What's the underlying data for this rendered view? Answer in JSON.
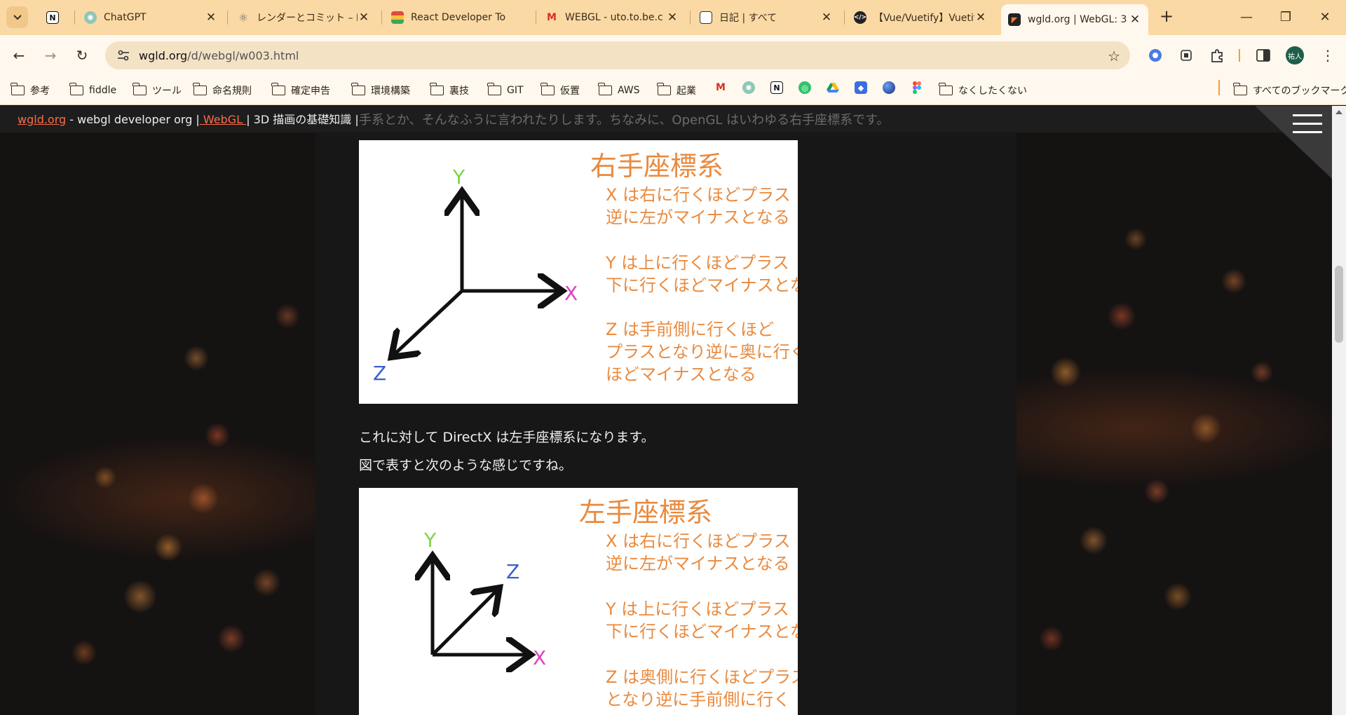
{
  "tabs": [
    {
      "label": "",
      "favicon": "notion-icon"
    },
    {
      "label": "ChatGPT",
      "favicon": "chatgpt-icon"
    },
    {
      "label": "レンダーとコミット – Re",
      "favicon": "react-icon"
    },
    {
      "label": "React Developer To",
      "favicon": "chrome-webstore-icon"
    },
    {
      "label": "WEBGL - uto.to.be.c",
      "favicon": "gmail-icon"
    },
    {
      "label": "日記 | すべて",
      "favicon": "diary-icon"
    },
    {
      "label": "【Vue/Vuetify】Vuetif",
      "favicon": "code-icon"
    },
    {
      "label": "wgld.org | WebGL: 3",
      "favicon": "wgld-icon",
      "active": true
    }
  ],
  "toolbar": {
    "url_host": "wgld.org",
    "url_path": "/d/webgl/w003.html",
    "profile_initials": "祐人"
  },
  "bookmarks": {
    "items": [
      "参考",
      "fiddle",
      "ツール",
      "命名規則",
      "確定申告",
      "環境構築",
      "裏技",
      "GIT",
      "仮置",
      "AWS",
      "起業"
    ],
    "last_folder": "なくしたくない",
    "all_bookmarks": "すべてのブックマーク"
  },
  "site": {
    "home_link": "wgld.org",
    "org_text": " - webgl developer org |",
    "webgl_link": " WebGL ",
    "page_text": "| 3D 描画の基礎知識 |",
    "faded_line": "手系とか、そんなふうに言われたりします。ちなみに、OpenGL はいわゆる右手座標系です。"
  },
  "article": {
    "figure1": {
      "title": "右手座標系",
      "axis_y": "Y",
      "axis_x": "X",
      "axis_z": "Z",
      "desc_x": [
        "X は右に行くほどプラス",
        "逆に左がマイナスとなる"
      ],
      "desc_y": [
        "Y は上に行くほどプラス",
        "下に行くほどマイナスとなる"
      ],
      "desc_z": [
        "Z は手前側に行くほど",
        "プラスとなり逆に奥に行く",
        "ほどマイナスとなる"
      ]
    },
    "para1": "これに対して DirectX は左手座標系になります。",
    "para2": "図で表すと次のような感じですね。",
    "figure2": {
      "title": "左手座標系",
      "axis_y": "Y",
      "axis_x": "X",
      "axis_z": "Z",
      "desc_x": [
        "X は右に行くほどプラス",
        "逆に左がマイナスとなる"
      ],
      "desc_y": [
        "Y は上に行くほどプラス",
        "下に行くほどマイナスとなる"
      ],
      "desc_z": [
        "Z は奥側に行くほどプラス",
        "となり逆に手前側に行く"
      ]
    }
  },
  "colors": {
    "accent_orange": "#e98a3e",
    "axis_y_green": "#7ed34a",
    "axis_x_magenta": "#e040c0",
    "axis_z_blue": "#3a5fd0",
    "link_red": "#ff6a4a"
  }
}
